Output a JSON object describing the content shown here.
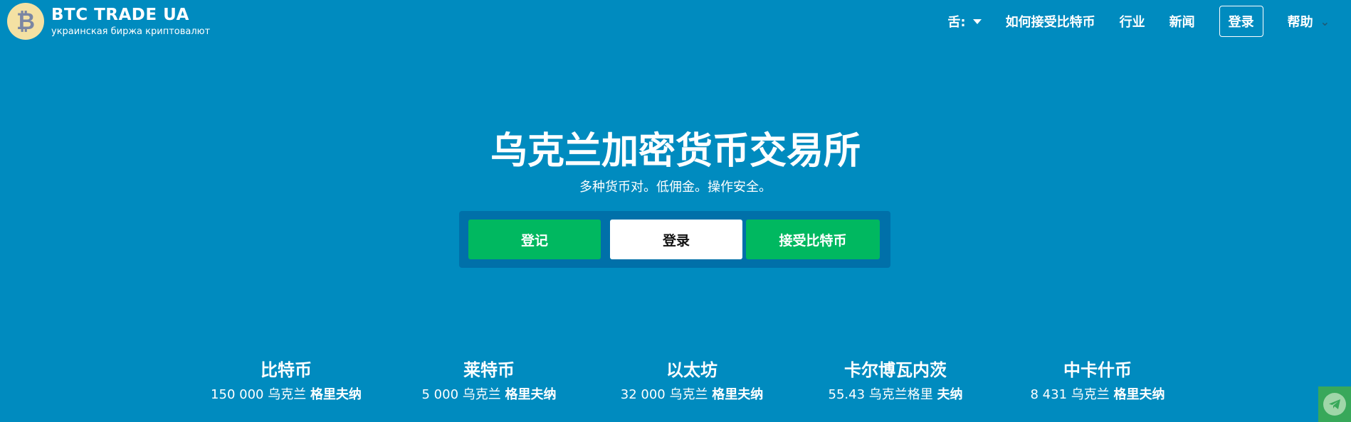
{
  "header": {
    "logo_symbol": "₿",
    "title": "BTC TRADE UA",
    "subtitle": "украинская биржа криптовалют",
    "nav": {
      "language": "舌:",
      "how_to_accept": "如何接受比特币",
      "industry": "行业",
      "news": "新闻",
      "login": "登录",
      "help": "帮助"
    }
  },
  "hero": {
    "title": "乌克兰加密货币交易所",
    "subtitle": "多种货币对。低佣金。操作安全。",
    "buttons": {
      "register": "登记",
      "login": "登录",
      "accept_bitcoin": "接受比特币"
    }
  },
  "coins": [
    {
      "name": "比特币",
      "amount": "150 000 乌克兰",
      "unit": "格里夫纳"
    },
    {
      "name": "莱特币",
      "amount": "5 000 乌克兰",
      "unit": "格里夫纳"
    },
    {
      "name": "以太坊",
      "amount": "32 000 乌克兰",
      "unit": "格里夫纳"
    },
    {
      "name": "卡尔博瓦内茨",
      "amount": "55.43 乌克兰格里",
      "unit": "夫纳"
    },
    {
      "name": "中卡什币",
      "amount": "8 431 乌克兰",
      "unit": "格里夫纳"
    }
  ],
  "colors": {
    "background": "#008bbf",
    "panel": "#0070a9",
    "green": "#00b860",
    "logo": "#f4e1a3"
  },
  "icons": {
    "logo": "bitcoin-icon",
    "language_dropdown": "caret-down-icon",
    "help_dropdown": "chevron-down-icon",
    "telegram": "telegram-icon"
  }
}
